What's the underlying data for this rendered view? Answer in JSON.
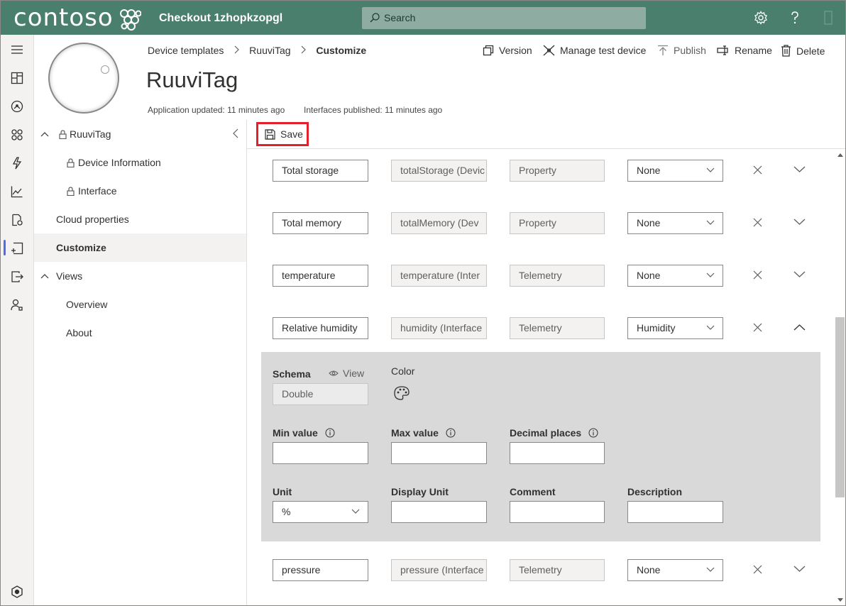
{
  "app": {
    "brand": "contoso",
    "title": "Checkout 1zhopkzopgl",
    "search_placeholder": "Search",
    "brand_color": "#4a7f6e"
  },
  "header": {
    "breadcrumb": [
      "Device templates",
      "RuuviTag",
      "Customize"
    ],
    "title": "RuuviTag",
    "app_updated": "Application updated: 11 minutes ago",
    "interfaces_published": "Interfaces published: 11 minutes ago",
    "commands": {
      "version": "Version",
      "manage": "Manage test device",
      "publish": "Publish",
      "rename": "Rename",
      "delete": "Delete"
    }
  },
  "nav": {
    "root": "RuuviTag",
    "device_information": "Device Information",
    "interface": "Interface",
    "cloud_properties": "Cloud properties",
    "customize": "Customize",
    "views": "Views",
    "overview": "Overview",
    "about": "About"
  },
  "toolbar": {
    "save_label": "Save"
  },
  "rows": [
    {
      "display_name": "Total storage",
      "name": "totalStorage (Devic",
      "type": "Property",
      "semantic": "None",
      "expanded": false
    },
    {
      "display_name": "Total memory",
      "name": "totalMemory (Dev",
      "type": "Property",
      "semantic": "None",
      "expanded": false
    },
    {
      "display_name": "temperature",
      "name": "temperature (Inter",
      "type": "Telemetry",
      "semantic": "None",
      "expanded": false
    },
    {
      "display_name": "Relative humidity",
      "name": "humidity (Interface",
      "type": "Telemetry",
      "semantic": "Humidity",
      "expanded": true
    },
    {
      "display_name": "pressure",
      "name": "pressure (Interface",
      "type": "Telemetry",
      "semantic": "None",
      "expanded": false
    }
  ],
  "detail": {
    "schema_label": "Schema",
    "view_label": "View",
    "schema_value": "Double",
    "color_label": "Color",
    "min_label": "Min value",
    "max_label": "Max value",
    "decimal_label": "Decimal places",
    "unit_label": "Unit",
    "unit_value": "%",
    "display_unit_label": "Display Unit",
    "comment_label": "Comment",
    "description_label": "Description"
  }
}
